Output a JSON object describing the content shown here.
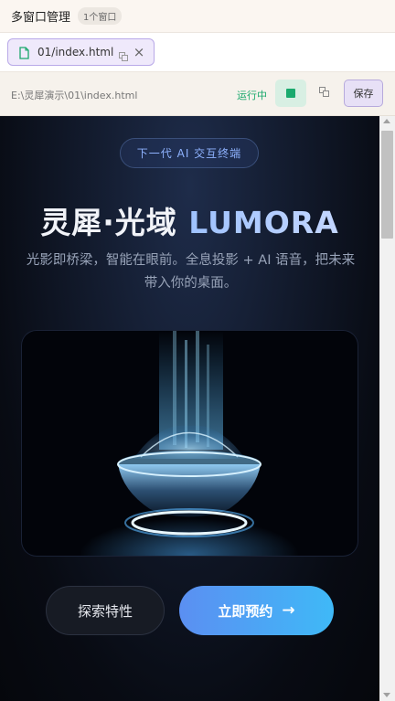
{
  "app": {
    "title": "多窗口管理",
    "window_count": "1个窗口"
  },
  "tabs": [
    {
      "label": "01/index.html"
    }
  ],
  "address": {
    "path": "E:\\灵犀演示\\01\\index.html",
    "status": "运行中",
    "save_label": "保存"
  },
  "preview": {
    "badge": "下一代 AI 交互终端",
    "title_main": "灵犀·光域 ",
    "title_brand": "LUMORA",
    "subtitle": "光影即桥梁，智能在眼前。全息投影 + AI 语音，把未来带入你的桌面。",
    "secondary_button": "探索特性",
    "primary_button": "立即预约",
    "primary_icon": "→"
  },
  "colors": {
    "accent": "#5b8ff2",
    "status": "#19a86b",
    "brand_blue": "#9ec2ff"
  }
}
